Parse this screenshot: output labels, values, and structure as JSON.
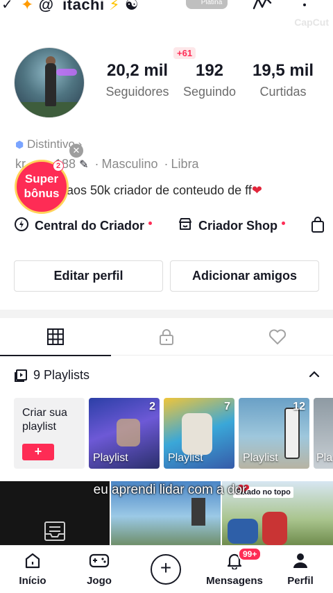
{
  "header": {
    "username_prefix": "@",
    "username": "itachi",
    "rank_badge": "Platina",
    "watermark": "CapCut",
    "icons": [
      "star-icon",
      "lightning-icon",
      "yin-yang-icon",
      "squiggle-icon",
      "more-icon"
    ]
  },
  "profile": {
    "new_followers_badge": "+61",
    "stats": [
      {
        "value": "20,2 mil",
        "label": "Seguidores"
      },
      {
        "value": "192",
        "label": "Seguindo"
      },
      {
        "value": "19,5 mil",
        "label": "Curtidas"
      }
    ],
    "distintivo": "Distintivo",
    "handle_partial": "kr",
    "handle_suffix": "188",
    "gender": "Masculino",
    "sign": "Libra",
    "bio": "aos 50k criador de conteudo de ff",
    "super_bonus": {
      "line1": "Super",
      "line2": "bônus",
      "count": "2"
    }
  },
  "links": {
    "creator_center": "Central do Criador",
    "creator_shop": "Criador Shop"
  },
  "buttons": {
    "edit_profile": "Editar perfil",
    "add_friends": "Adicionar amigos"
  },
  "playlists": {
    "header": "9 Playlists",
    "create_label": "Criar sua playlist",
    "create_button": "+",
    "items": [
      {
        "label": "Playlist",
        "count": "2"
      },
      {
        "label": "Playlist",
        "count": "7"
      },
      {
        "label": "Playlist",
        "count": "12"
      },
      {
        "label": "Pla",
        "count": ""
      }
    ]
  },
  "videos": {
    "caption": "eu aprendi lidar com a dor",
    "pinned_tag": "Fixado no topo"
  },
  "bottom_nav": {
    "home": "Início",
    "game": "Jogo",
    "create": "+",
    "messages": "Mensagens",
    "messages_badge": "99+",
    "profile": "Perfil"
  },
  "colors": {
    "accent": "#fe2c55",
    "text": "#161823",
    "muted": "#8a8a8a"
  }
}
